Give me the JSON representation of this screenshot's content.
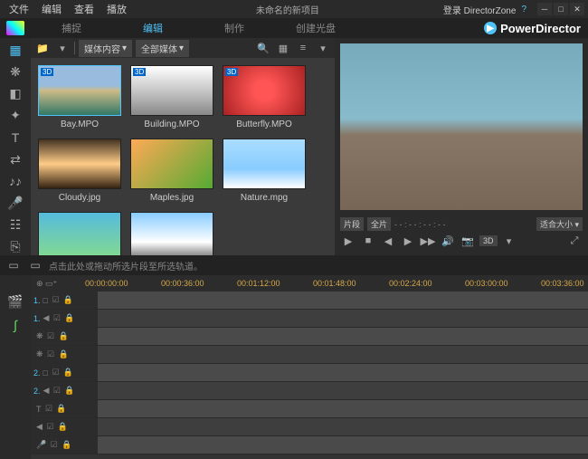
{
  "menu": {
    "file": "文件",
    "edit": "编辑",
    "view": "查看",
    "play": "播放"
  },
  "title": "未命名的新项目",
  "login": "登录 DirectorZone",
  "brand": "PowerDirector",
  "tabs": {
    "capture": "捕捉",
    "edit": "编辑",
    "produce": "制作",
    "createDisc": "创建光盘"
  },
  "library": {
    "dd1": "媒体内容",
    "dd2": "全部媒体",
    "items": [
      {
        "name": "Bay.MPO",
        "badge": "3D",
        "cls": "t-bay",
        "sel": true
      },
      {
        "name": "Building.MPO",
        "badge": "3D",
        "cls": "t-bld"
      },
      {
        "name": "Butterfly.MPO",
        "badge": "3D",
        "cls": "t-bfly"
      },
      {
        "name": "Cloudy.jpg",
        "cls": "t-cloud"
      },
      {
        "name": "Maples.jpg",
        "cls": "t-maple"
      },
      {
        "name": "Nature.mpg",
        "cls": "t-nat"
      },
      {
        "name": "",
        "cls": "t-ext1"
      },
      {
        "name": "",
        "cls": "t-ext2"
      }
    ]
  },
  "preview": {
    "clip": "片段",
    "full": "全片",
    "time": "- - : - - : - - : - -",
    "fit": "适合大小",
    "threeD": "3D"
  },
  "timeline": {
    "hint": "点击此处或拖动所选片段至所选轨道。",
    "marks": [
      "00:00:00:00",
      "00:00:36:00",
      "00:01:12:00",
      "00:01:48:00",
      "00:02:24:00",
      "00:03:00:00",
      "00:03:36:00"
    ],
    "tracks": [
      {
        "n": "1.",
        "t": "□"
      },
      {
        "n": "1.",
        "t": "◀"
      },
      {
        "n": "",
        "t": "❋"
      },
      {
        "n": "",
        "t": "❋"
      },
      {
        "n": "2.",
        "t": "□"
      },
      {
        "n": "2.",
        "t": "◀"
      },
      {
        "n": "",
        "t": "T"
      },
      {
        "n": "",
        "t": "◀"
      },
      {
        "n": "",
        "t": "🎤"
      }
    ]
  }
}
